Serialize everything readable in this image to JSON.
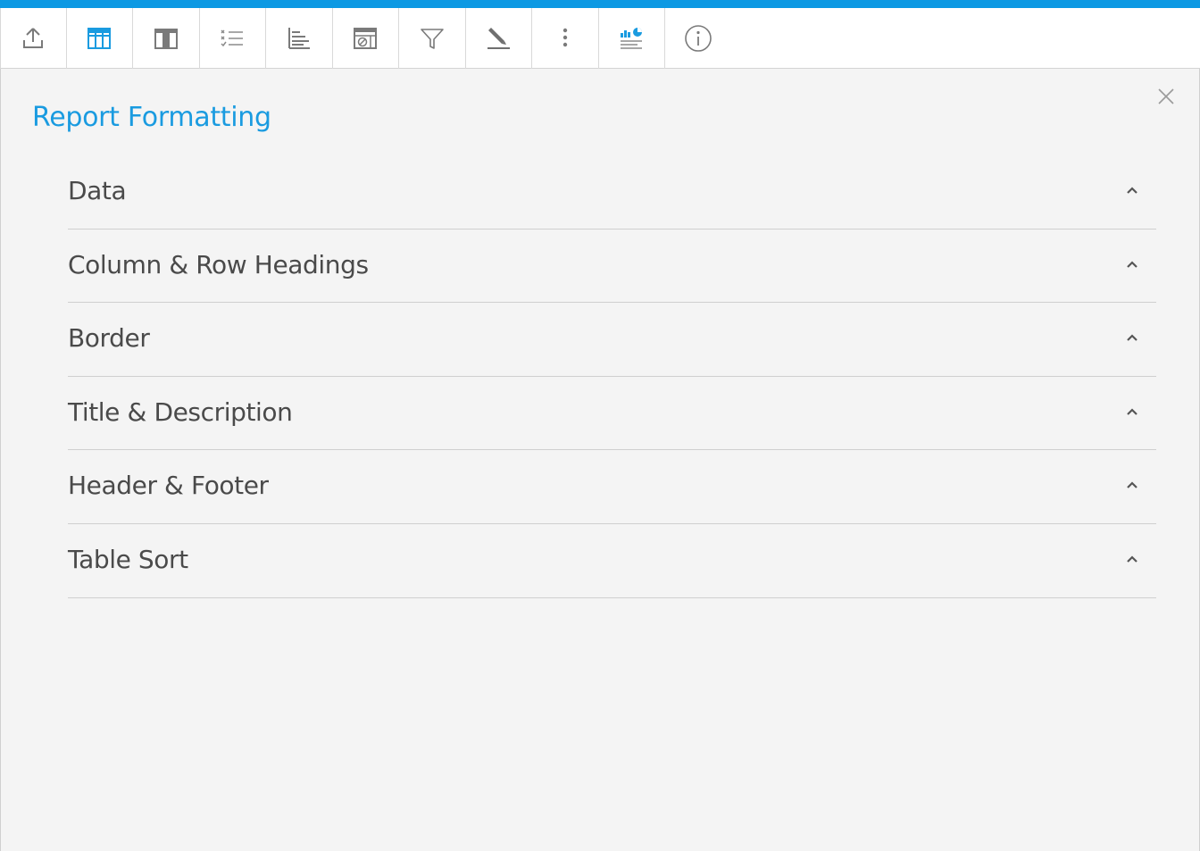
{
  "colors": {
    "accent": "#0d99e3",
    "title": "#1a9be0",
    "text": "#4a4a4a",
    "icon": "#8a8a8a",
    "panel_bg": "#f4f4f4"
  },
  "toolbar": {
    "buttons": [
      {
        "icon": "export-icon",
        "active": false
      },
      {
        "icon": "table-columns-icon",
        "active": true
      },
      {
        "icon": "table-select-icon",
        "active": false
      },
      {
        "icon": "checklist-icon",
        "active": false
      },
      {
        "icon": "bar-list-icon",
        "active": false
      },
      {
        "icon": "calculated-field-icon",
        "active": false
      },
      {
        "icon": "filter-icon",
        "active": false
      },
      {
        "icon": "pencil-format-icon",
        "active": false
      },
      {
        "icon": "more-vertical-icon",
        "active": false
      },
      {
        "icon": "chart-icon",
        "active": false
      },
      {
        "icon": "info-icon",
        "active": false
      }
    ]
  },
  "panel": {
    "title": "Report Formatting",
    "close_icon": "close-icon",
    "sections": [
      {
        "label": "Data",
        "icon": "chevron-up-icon"
      },
      {
        "label": "Column & Row Headings",
        "icon": "chevron-up-icon"
      },
      {
        "label": "Border",
        "icon": "chevron-up-icon"
      },
      {
        "label": "Title & Description",
        "icon": "chevron-up-icon"
      },
      {
        "label": "Header & Footer",
        "icon": "chevron-up-icon"
      },
      {
        "label": "Table Sort",
        "icon": "chevron-up-icon"
      }
    ]
  }
}
